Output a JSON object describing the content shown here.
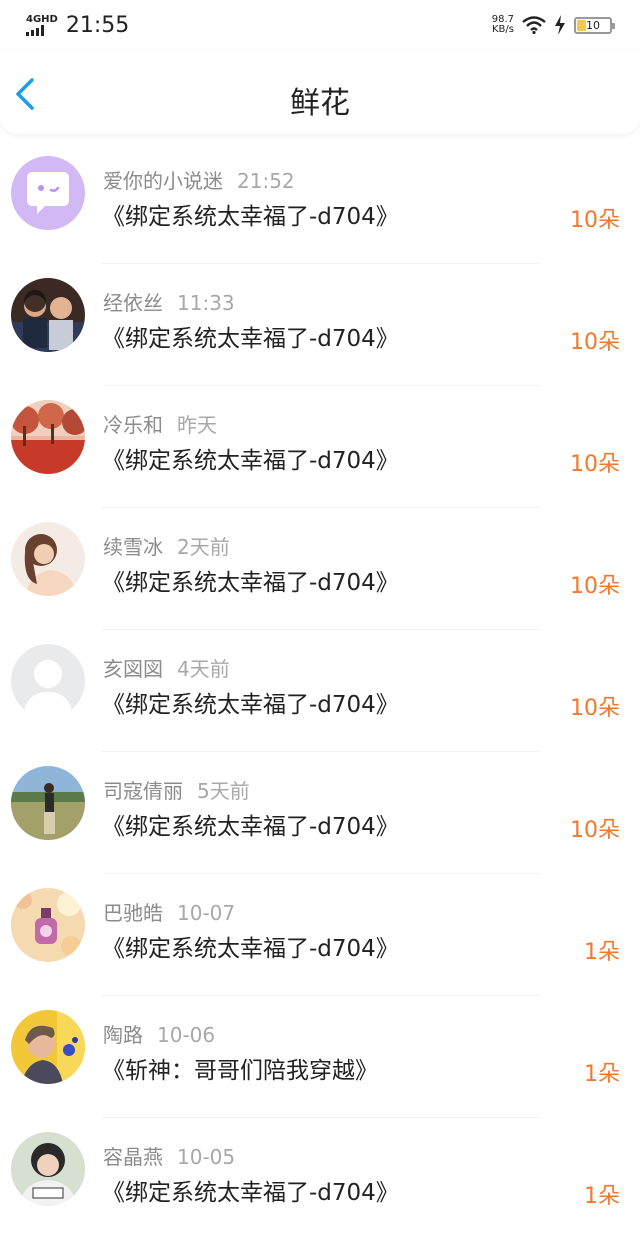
{
  "status": {
    "network_type": "4GHD",
    "time": "21:55",
    "speed_value": "98.7",
    "speed_unit": "KB/s",
    "battery_level": "10",
    "battery_color": "#f5c84a"
  },
  "header": {
    "title": "鲜花"
  },
  "colors": {
    "accent": "#1e9bea",
    "count": "#f5772a"
  },
  "items": [
    {
      "name": "爱你的小说迷",
      "time": "21:52",
      "book": "《绑定系统太幸福了-d704》",
      "count": "10朵"
    },
    {
      "name": "经依丝",
      "time": "11:33",
      "book": "《绑定系统太幸福了-d704》",
      "count": "10朵"
    },
    {
      "name": "冷乐和",
      "time": "昨天",
      "book": "《绑定系统太幸福了-d704》",
      "count": "10朵"
    },
    {
      "name": "续雪冰",
      "time": "2天前",
      "book": "《绑定系统太幸福了-d704》",
      "count": "10朵"
    },
    {
      "name": "亥図図",
      "time": "4天前",
      "book": "《绑定系统太幸福了-d704》",
      "count": "10朵"
    },
    {
      "name": "司寇倩丽",
      "time": "5天前",
      "book": "《绑定系统太幸福了-d704》",
      "count": "10朵"
    },
    {
      "name": "巴驰皓",
      "time": "10-07",
      "book": "《绑定系统太幸福了-d704》",
      "count": "1朵"
    },
    {
      "name": "陶路",
      "time": "10-06",
      "book": "《斩神：哥哥们陪我穿越》",
      "count": "1朵"
    },
    {
      "name": "容晶燕",
      "time": "10-05",
      "book": "《绑定系统太幸福了-d704》",
      "count": "1朵"
    }
  ]
}
